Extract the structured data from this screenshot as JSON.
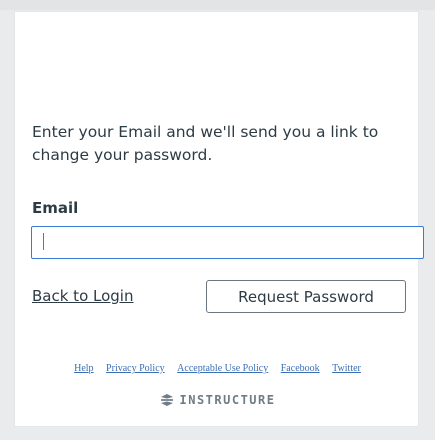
{
  "top_heading_fragment": "",
  "form": {
    "intro_text": "Enter your Email and we'll send you a link to change your password.",
    "email_label": "Email",
    "email_value": "",
    "email_placeholder": "",
    "back_link": "Back to Login",
    "request_button": "Request Password"
  },
  "footer": {
    "links": [
      "Help",
      "Privacy Policy",
      "Acceptable Use Policy",
      "Facebook",
      "Twitter"
    ],
    "brand": "INSTRUCTURE",
    "brand_icon": "instructure-logo-icon"
  },
  "colors": {
    "text": "#2d3b45",
    "input_focus_border": "#3b7bd4",
    "link": "#3b6fb5",
    "brand_gray": "#6f7c85",
    "background": "#e9ebed"
  }
}
